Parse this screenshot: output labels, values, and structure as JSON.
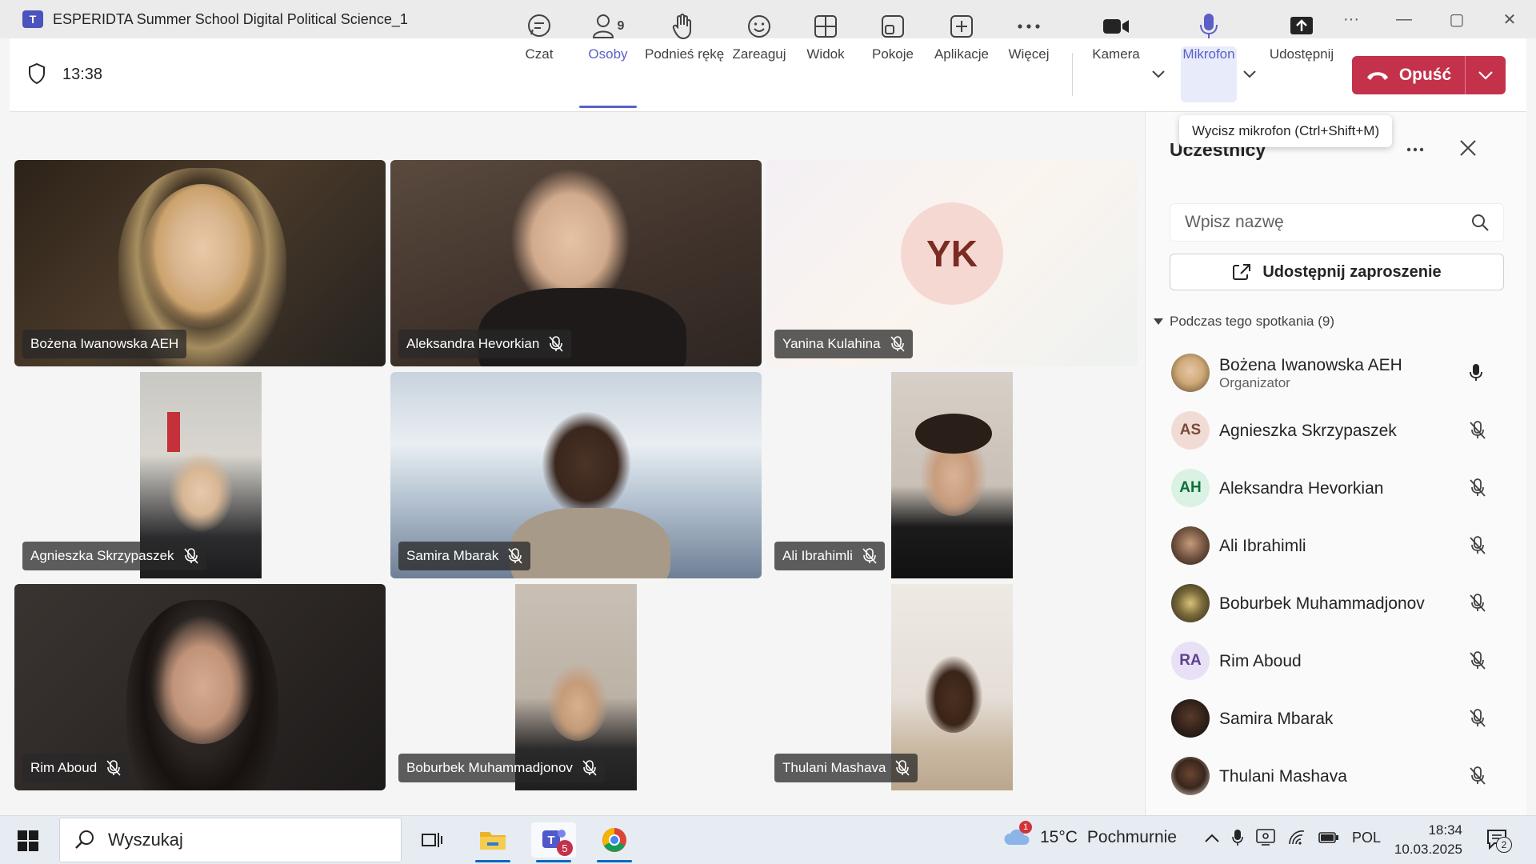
{
  "window": {
    "title": "ESPERIDTA Summer School Digital Political Science_1",
    "logo": "teams-icon",
    "controls": [
      "···",
      "—",
      "▢",
      "✕"
    ]
  },
  "toolbar": {
    "clock": "13:38",
    "people_count": "9",
    "buttons": {
      "chat": "Czat",
      "people": "Osoby",
      "raise_hand": "Podnieś rękę",
      "react": "Zareaguj",
      "view": "Widok",
      "rooms": "Pokoje",
      "apps": "Aplikacje",
      "more": "Więcej",
      "camera": "Kamera",
      "mic": "Mikrofon",
      "share": "Udostępnij",
      "leave": "Opuść"
    },
    "tooltip": "Wycisz mikrofon (Ctrl+Shift+M)"
  },
  "tiles": [
    {
      "name": "Bożena Iwanowska AEH",
      "muted": false
    },
    {
      "name": "Aleksandra Hevorkian",
      "muted": true
    },
    {
      "name": "Yanina Kulahina",
      "muted": true,
      "initials": "YK"
    },
    {
      "name": "Agnieszka Skrzypaszek",
      "muted": true
    },
    {
      "name": "Samira Mbarak",
      "muted": true
    },
    {
      "name": "Ali Ibrahimli",
      "muted": true
    },
    {
      "name": "Rim Aboud",
      "muted": true
    },
    {
      "name": "Boburbek Muhammadjonov",
      "muted": true
    },
    {
      "name": "Thulani Mashava",
      "muted": true
    }
  ],
  "panel": {
    "title": "Uczestnicy",
    "search_placeholder": "Wpisz nazwę",
    "invite_label": "Udostępnij zaproszenie",
    "section_label": "Podczas tego spotkania (9)",
    "participants": [
      {
        "name": "Bożena Iwanowska AEH",
        "role": "Organizator",
        "initials": "",
        "mic": "on"
      },
      {
        "name": "Agnieszka Skrzypaszek",
        "role": "",
        "initials": "AS",
        "mic": "off"
      },
      {
        "name": "Aleksandra Hevorkian",
        "role": "",
        "initials": "AH",
        "mic": "off"
      },
      {
        "name": "Ali Ibrahimli",
        "role": "",
        "initials": "",
        "mic": "off"
      },
      {
        "name": "Boburbek Muhammadjonov",
        "role": "",
        "initials": "",
        "mic": "off"
      },
      {
        "name": "Rim Aboud",
        "role": "",
        "initials": "RA",
        "mic": "off"
      },
      {
        "name": "Samira Mbarak",
        "role": "",
        "initials": "",
        "mic": "off"
      },
      {
        "name": "Thulani Mashava",
        "role": "",
        "initials": "",
        "mic": "off"
      }
    ]
  },
  "taskbar": {
    "search_label": "Wyszukaj",
    "teams_badge": "5",
    "weather_badge": "1",
    "temperature": "15°C",
    "weather": "Pochmurnie",
    "language": "POL",
    "time": "18:34",
    "date": "10.03.2025",
    "notifications": "2"
  },
  "colors": {
    "accent": "#5b5fc7",
    "leave": "#c4314b"
  }
}
